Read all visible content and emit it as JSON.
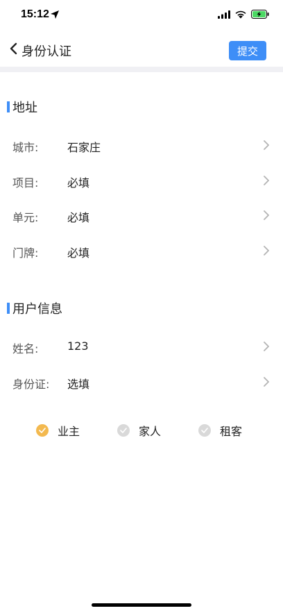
{
  "status_bar": {
    "time": "15:12",
    "icons": [
      "location-arrow-icon",
      "cellular-signal-icon",
      "wifi-icon",
      "battery-charging-icon"
    ]
  },
  "nav": {
    "back_icon": "chevron-left-icon",
    "title": "身份认证",
    "submit_label": "提交"
  },
  "sections": {
    "address": {
      "title": "地址",
      "rows": [
        {
          "label": "城市:",
          "value": "石家庄"
        },
        {
          "label": "项目:",
          "value": "必填"
        },
        {
          "label": "单元:",
          "value": "必填"
        },
        {
          "label": "门牌:",
          "value": "必填"
        }
      ]
    },
    "user_info": {
      "title": "用户信息",
      "rows": [
        {
          "label": "姓名:",
          "value": "123"
        },
        {
          "label": "身份证:",
          "value": "选填"
        }
      ]
    }
  },
  "roles": [
    {
      "label": "业主",
      "selected": true
    },
    {
      "label": "家人",
      "selected": false
    },
    {
      "label": "租客",
      "selected": false
    }
  ],
  "colors": {
    "accent": "#3e8ef7",
    "selected_dot": "#f3b94f",
    "unselected_dot": "#d9d9d9",
    "divider": "#f0f0f4"
  }
}
